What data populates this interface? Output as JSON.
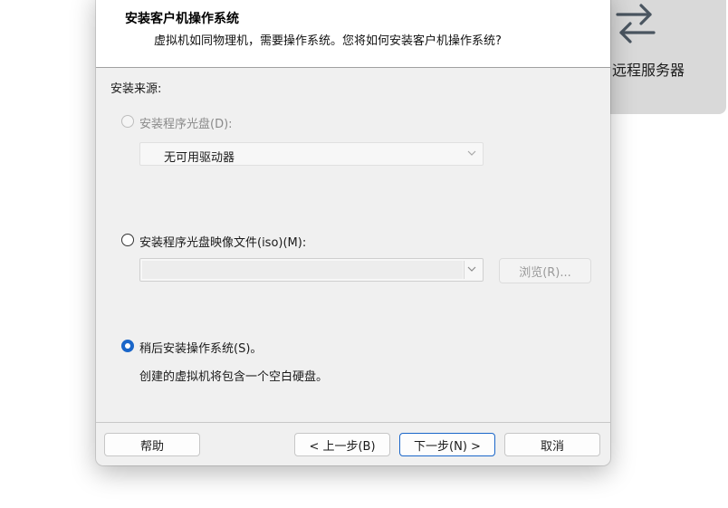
{
  "background_card": {
    "icon": "swap-arrows-icon",
    "label": "远程服务器"
  },
  "dialog": {
    "header": {
      "title": "安装客户机操作系统",
      "subtitle": "虚拟机如同物理机，需要操作系统。您将如何安装客户机操作系统?"
    },
    "install_source_label": "安装来源:",
    "option_disc": {
      "label": "安装程序光盘(D):",
      "selected": false,
      "enabled": false,
      "drive_value": "无可用驱动器"
    },
    "option_iso": {
      "label": "安装程序光盘映像文件(iso)(M):",
      "selected": false,
      "enabled": true,
      "path_value": "",
      "browse_label": "浏览(R)..."
    },
    "option_later": {
      "label": "稍后安装操作系统(S)。",
      "selected": true,
      "enabled": true,
      "description": "创建的虚拟机将包含一个空白硬盘。"
    },
    "footer": {
      "help_label": "帮助",
      "back_label": "< 上一步(B)",
      "next_label": "下一步(N) >",
      "cancel_label": "取消"
    }
  },
  "colors": {
    "accent": "#1a66c9",
    "dialog_bg": "#f0f0f0",
    "header_bg": "#ffffff",
    "card_bg": "#d9d9d9"
  }
}
